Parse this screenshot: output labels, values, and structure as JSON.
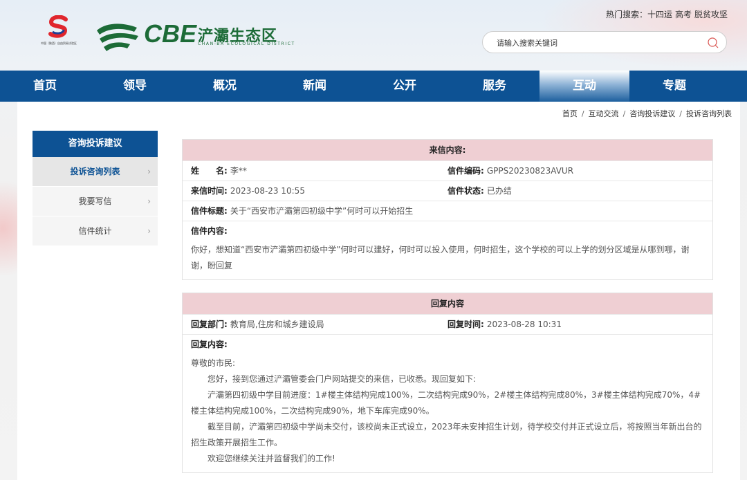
{
  "header": {
    "logo_caption": "中国（陕西）自由贸易试验区",
    "cbe_text": "CBE",
    "cbe_name": "浐灞生态区",
    "cbe_en": "CHAN-BA ECOLOGICAL DISTRICT",
    "hot_label": "热门搜索：",
    "hot_terms": [
      "十四运",
      "高考",
      "脱贫攻坚"
    ],
    "search_placeholder": "请输入搜索关键词"
  },
  "nav": [
    "首页",
    "领导",
    "概况",
    "新闻",
    "公开",
    "服务",
    "互动",
    "专题"
  ],
  "nav_active": "互动",
  "breadcrumb": [
    "首页",
    "互动交流",
    "咨询投诉建议",
    "投诉咨询列表"
  ],
  "sidebar": {
    "title": "咨询投诉建议",
    "items": [
      {
        "label": "投诉咨询列表"
      },
      {
        "label": "我要写信"
      },
      {
        "label": "信件统计"
      }
    ]
  },
  "letter": {
    "header": "来信内容:",
    "name_label": "姓　　名:",
    "name_value": "李**",
    "code_label": "信件编码:",
    "code_value": "GPPS20230823AVUR",
    "time_label": "来信时间:",
    "time_value": "2023-08-23 10:55",
    "status_label": "信件状态:",
    "status_value": "已办结",
    "title_label": "信件标题:",
    "title_value": "关于“西安市浐灞第四初级中学”何时可以开始招生",
    "content_label": "信件内容:",
    "content_value": "你好，想知道“西安市浐灞第四初级中学”何时可以建好，何时可以投入使用，何时招生，这个学校的可以上学的划分区域是从哪到哪，谢谢，盼回复"
  },
  "reply": {
    "header": "回复内容",
    "dept_label": "回复部门:",
    "dept_value": "教育局,住房和城乡建设局",
    "time_label": "回复时间:",
    "time_value": "2023-08-28 10:31",
    "content_label": "回复内容:",
    "greeting": "尊敬的市民:",
    "p1": "您好，接到您通过浐灞管委会门户网站提交的来信，已收悉。现回复如下:",
    "p2": "浐灞第四初级中学目前进度：1#楼主体结构完成100%，二次结构完成90%，2#楼主体结构完成80%，3#楼主体结构完成70%，4#楼主体结构完成100%，二次结构完成90%，地下车库完成90%。",
    "p3": "截至目前，浐灞第四初级中学尚未交付，该校尚未正式设立，2023年未安排招生计划，待学校交付并正式设立后，将按照当年新出台的招生政策开展招生工作。",
    "p4": "欢迎您继续关注并监督我们的工作!"
  },
  "colors": {
    "nav_bg": "#0d5294",
    "box_head_bg": "#efcfd3",
    "brand_green": "#1c6b37"
  }
}
